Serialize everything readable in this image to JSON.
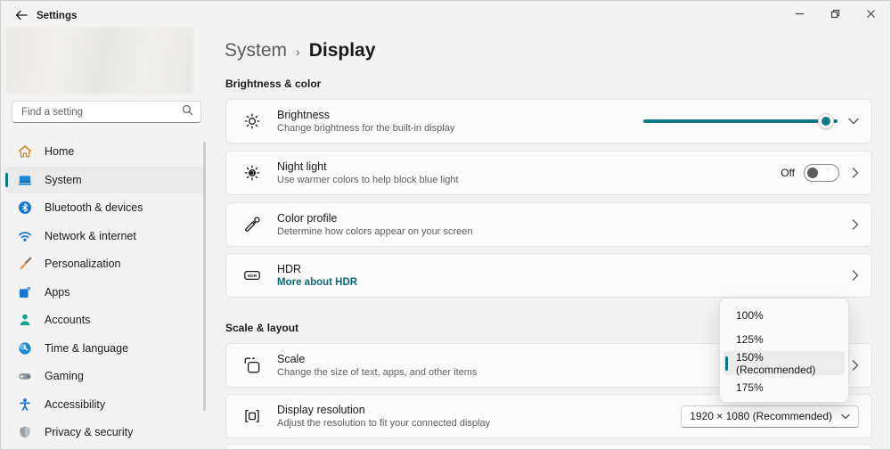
{
  "colors": {
    "accent": "#0f7b84",
    "link": "#0c6a7d"
  },
  "titlebar": {
    "app_title": "Settings",
    "back_icon": "back-arrow-icon",
    "controls": [
      "minimize-icon",
      "restore-icon",
      "close-icon"
    ]
  },
  "sidebar": {
    "search_placeholder": "Find a setting",
    "search_icon": "search-icon",
    "items": [
      {
        "label": "Home",
        "icon": "home-icon",
        "selected": false
      },
      {
        "label": "System",
        "icon": "system-icon",
        "selected": true
      },
      {
        "label": "Bluetooth & devices",
        "icon": "bluetooth-icon",
        "selected": false
      },
      {
        "label": "Network & internet",
        "icon": "network-icon",
        "selected": false
      },
      {
        "label": "Personalization",
        "icon": "personalization-icon",
        "selected": false
      },
      {
        "label": "Apps",
        "icon": "apps-icon",
        "selected": false
      },
      {
        "label": "Accounts",
        "icon": "accounts-icon",
        "selected": false
      },
      {
        "label": "Time & language",
        "icon": "time-language-icon",
        "selected": false
      },
      {
        "label": "Gaming",
        "icon": "gaming-icon",
        "selected": false
      },
      {
        "label": "Accessibility",
        "icon": "accessibility-icon",
        "selected": false
      },
      {
        "label": "Privacy & security",
        "icon": "privacy-security-icon",
        "selected": false
      }
    ]
  },
  "breadcrumb": {
    "parent": "System",
    "separator": "›",
    "current": "Display"
  },
  "sections": {
    "brightness_color": {
      "heading": "Brightness & color",
      "brightness": {
        "title": "Brightness",
        "subtitle": "Change brightness for the built-in display",
        "icon": "brightness-sun-icon",
        "slider_percent": 94
      },
      "night_light": {
        "title": "Night light",
        "subtitle": "Use warmer colors to help block blue light",
        "icon": "night-light-icon",
        "toggle_state": "Off"
      },
      "color_profile": {
        "title": "Color profile",
        "subtitle": "Determine how colors appear on your screen",
        "icon": "color-dropper-icon"
      },
      "hdr": {
        "title": "HDR",
        "link": "More about HDR",
        "icon": "hdr-badge-icon"
      }
    },
    "scale_layout": {
      "heading": "Scale & layout",
      "scale": {
        "title": "Scale",
        "subtitle": "Change the size of text, apps, and other items",
        "icon": "scale-icon"
      },
      "display_resolution": {
        "title": "Display resolution",
        "subtitle": "Adjust the resolution to fit your connected display",
        "icon": "resolution-icon",
        "value": "1920 × 1080 (Recommended)"
      }
    }
  },
  "scale_flyout": {
    "options": [
      {
        "label": "100%",
        "selected": false
      },
      {
        "label": "125%",
        "selected": false
      },
      {
        "label": "150% (Recommended)",
        "selected": true
      },
      {
        "label": "175%",
        "selected": false
      }
    ]
  }
}
